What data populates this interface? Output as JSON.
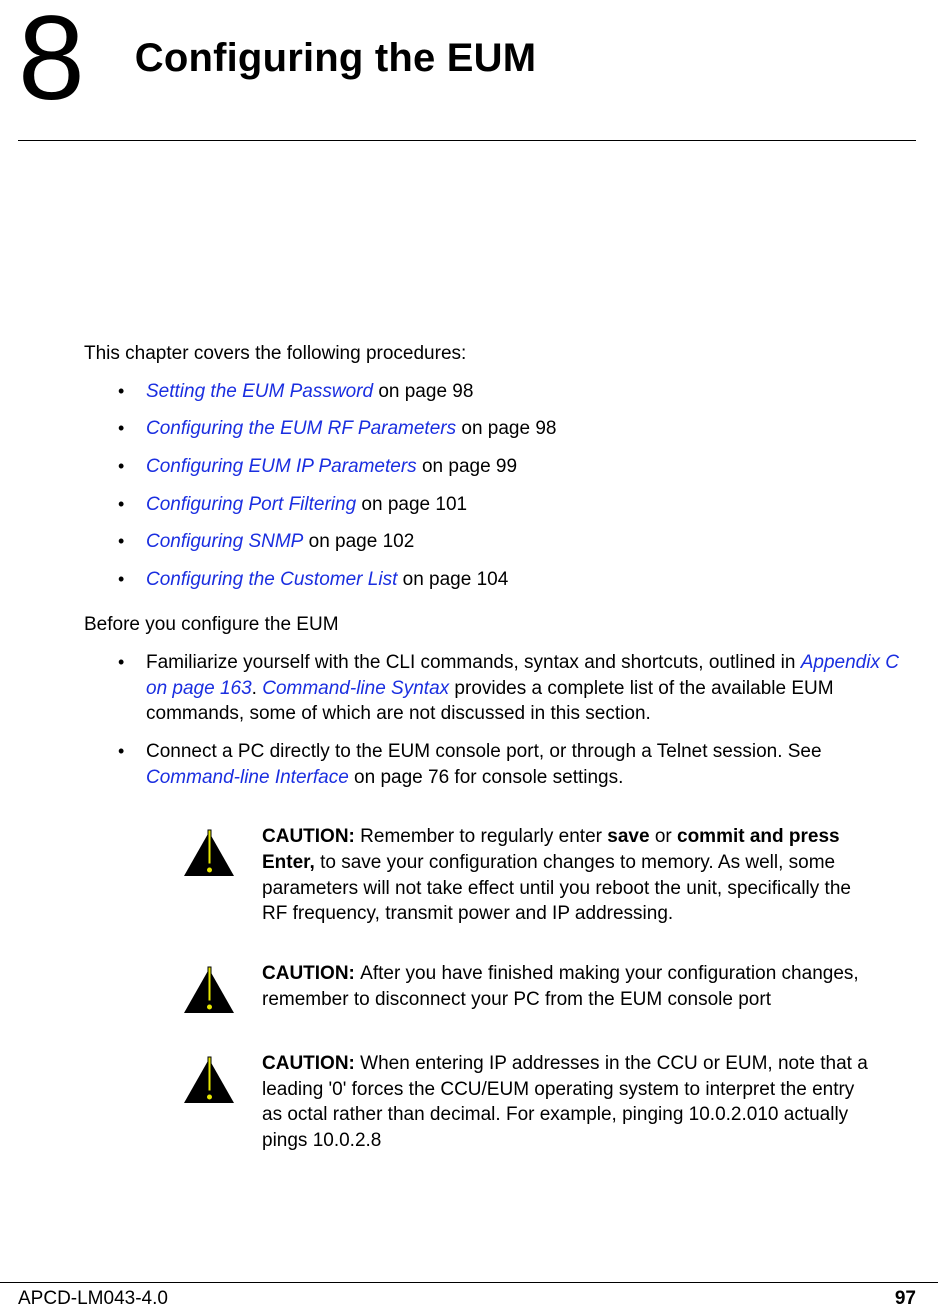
{
  "chapter": {
    "number": "8",
    "title": "Configuring the EUM"
  },
  "intro": "This chapter covers the following procedures:",
  "toc": [
    {
      "label": "Setting the EUM Password",
      "suffix": " on page 98"
    },
    {
      "label": "Configuring the EUM RF Parameters",
      "suffix": " on page 98"
    },
    {
      "label": "Configuring EUM IP Parameters",
      "suffix": " on page 99"
    },
    {
      "label": "Configuring Port Filtering",
      "suffix": " on page 101"
    },
    {
      "label": "Configuring SNMP",
      "suffix": " on page 102"
    },
    {
      "label": "Configuring the Customer List",
      "suffix": " on page 104"
    }
  ],
  "before_lead": "Before you configure the EUM",
  "before": [
    {
      "pre": "Familiarize yourself with the CLI commands, syntax and shortcuts, outlined in ",
      "link1": "Appendix C on page 163",
      "mid": ". ",
      "link2": "Command-line Syntax",
      "post": " provides a complete list of the available EUM commands, some of which are not discussed in this section."
    },
    {
      "pre": "Connect a PC directly to the EUM console port, or through a Telnet session. See ",
      "link1": "Command-line Interface",
      "mid": "",
      "link2": "",
      "post": " on page 76 for console settings."
    }
  ],
  "caution_label": "CAUTION:   ",
  "cautions": [
    {
      "pre": "Remember to regularly enter ",
      "b1": "save",
      "mid1": " or ",
      "b2": "commit and press Enter,",
      "post": " to save your configuration changes to memory. As well, some parameters will not take effect until you reboot the unit, specifically the RF frequency, transmit power and IP addressing."
    },
    {
      "pre": "After you have finished making your configuration changes, remember to disconnect your PC from the EUM console port",
      "b1": "",
      "mid1": "",
      "b2": "",
      "post": ""
    },
    {
      "pre": "When entering IP addresses in the CCU or EUM, note that a leading '0' forces the CCU/EUM operating system to interpret the entry as octal rather than decimal. For example, pinging 10.0.2.010 actually pings 10.0.2.8",
      "b1": "",
      "mid1": "",
      "b2": "",
      "post": ""
    }
  ],
  "footer": {
    "doc_id": "APCD-LM043-4.0",
    "page": "97"
  }
}
